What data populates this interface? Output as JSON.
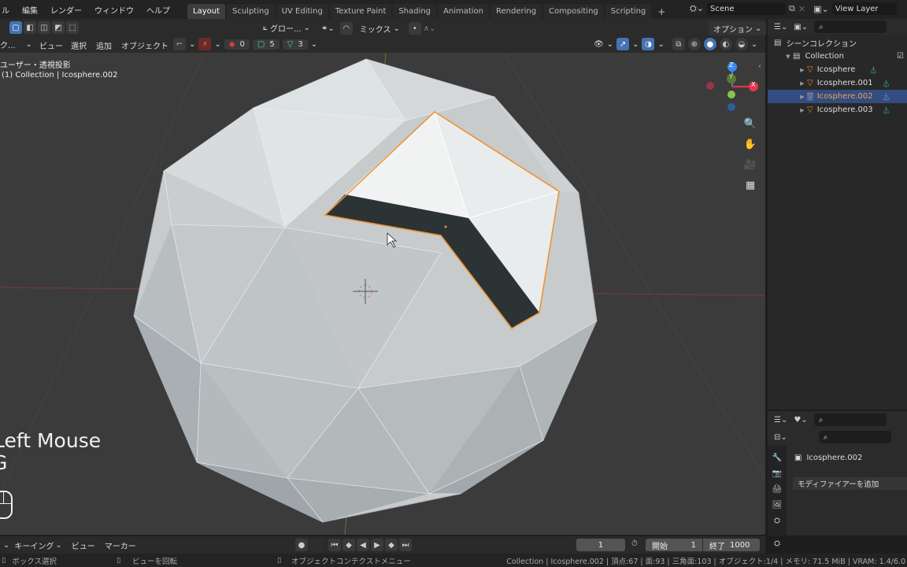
{
  "topbar": {
    "menus": [
      "編集",
      "レンダー",
      "ウィンドウ",
      "ヘルプ"
    ],
    "workspace_tabs": [
      "Layout",
      "Sculpting",
      "UV Editing",
      "Texture Paint",
      "Shading",
      "Animation",
      "Rendering",
      "Compositing",
      "Scripting"
    ],
    "active_tab": "Layout",
    "add_tab": "+",
    "scene_label": "Scene",
    "view_layer_label": "View Layer"
  },
  "viewport_header": {
    "transform_orientation": "グロー...",
    "snap_mode": "ミックス",
    "options_label": "オプション",
    "mode_label": "ク...",
    "menus": [
      "ビュー",
      "選択",
      "追加",
      "オブジェクト"
    ],
    "gizmo_counts": {
      "red": "0",
      "teal": "5",
      "green": "3"
    }
  },
  "viewport": {
    "view_name": "ユーザー・透視投影",
    "context": "(1) Collection | Icosphere.002",
    "keystroke_line1": "Left Mouse",
    "keystroke_line2": "G",
    "gizmo_axes": {
      "z": "Z",
      "y": "Y",
      "x": "X"
    }
  },
  "outliner": {
    "root_label": "シーンコレクション",
    "collection": "Collection",
    "items": [
      {
        "label": "Icosphere",
        "selected": false
      },
      {
        "label": "Icosphere.001",
        "selected": false
      },
      {
        "label": "Icosphere.002",
        "selected": true
      },
      {
        "label": "Icosphere.003",
        "selected": false
      }
    ]
  },
  "properties": {
    "object_name": "Icosphere.002",
    "add_modifier": "モディファイアーを追加"
  },
  "timeline": {
    "menus": [
      "キーイング",
      "ビュー",
      "マーカー"
    ],
    "current_frame": "1",
    "start_label": "開始",
    "start_value": "1",
    "end_label": "終了",
    "end_value": "1000"
  },
  "statusbar": {
    "left_hint": "ボックス選択",
    "middle_hint": "ビューを回転",
    "right_hint": "オブジェクトコンテクストメニュー",
    "stats": "Collection | Icosphere.002 | 頂点:67 | 面:93 | 三角面:103 | オブジェクト:1/4 | メモリ: 71.5 MiB | VRAM: 1.4/6.0"
  },
  "colors": {
    "accent": "#4772b3",
    "selection_outline": "#f0902c",
    "x_axis": "#e8364f",
    "y_axis": "#8bc34a",
    "z_axis": "#3b8cf0"
  }
}
